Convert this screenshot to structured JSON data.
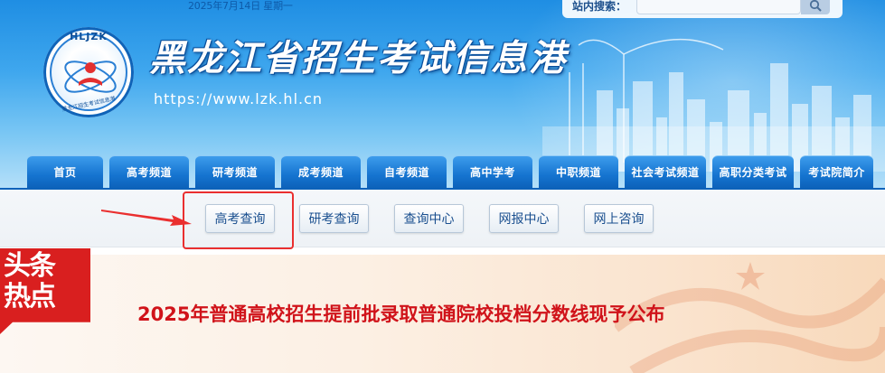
{
  "header": {
    "date": "2025年7月14日 星期一",
    "site_title": "黑龙江省招生考试信息港",
    "site_url": "https://www.lzk.hl.cn",
    "logo": {
      "top_text": "HLJZK",
      "bottom_text": "黑龙江招生考试信息港"
    }
  },
  "search": {
    "label": "站内搜索：",
    "placeholder": "",
    "button_icon": "search-icon"
  },
  "nav": {
    "items": [
      {
        "label": "首页"
      },
      {
        "label": "高考频道"
      },
      {
        "label": "研考频道"
      },
      {
        "label": "成考频道"
      },
      {
        "label": "自考频道"
      },
      {
        "label": "高中学考"
      },
      {
        "label": "中职频道"
      },
      {
        "label": "社会考试频道"
      },
      {
        "label": "高职分类考试"
      },
      {
        "label": "考试院简介"
      }
    ]
  },
  "subnav": {
    "items": [
      {
        "label": "高考查询"
      },
      {
        "label": "研考查询"
      },
      {
        "label": "查询中心"
      },
      {
        "label": "网报中心"
      },
      {
        "label": "网上咨询"
      }
    ]
  },
  "headline": {
    "badge_line1": "头条",
    "badge_line2": "热点",
    "text": "2025年普通高校招生提前批录取普通院校投档分数线现予公布"
  },
  "colors": {
    "nav_blue": "#1574d0",
    "highlight_red": "#ea2f2f",
    "headline_red": "#d0131a",
    "badge_red": "#d91f1f"
  }
}
